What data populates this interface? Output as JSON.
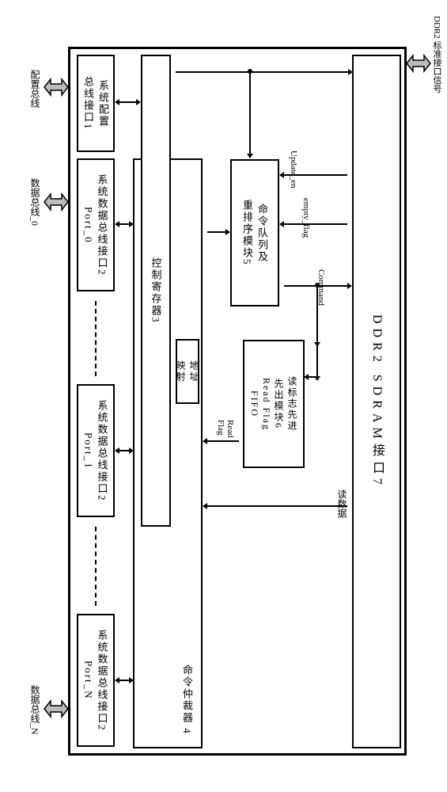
{
  "external": {
    "config_bus": "配置总线",
    "data_bus_0": "数据总线_0",
    "data_bus_n": "数据总线_N",
    "ddr2_signal": "DDR2 标准接口信号"
  },
  "blocks": {
    "config_if": "系统配置\n总线接口1",
    "data_port0": "系统数据总线接口2\nPort_0",
    "data_port1": "系统数据总线接口2\nPort_1",
    "data_portN": "系统数据总线接口2\nPort_N",
    "ctrl_reg": "控制寄存器3",
    "cmd_arbiter": "命令仲裁器  4",
    "addr_map": "地址\n映射",
    "cmd_queue": "命令队列及\n重排序模块5",
    "read_fifo": "读标志先进\n先出模块6\nRead Flag\nFIFO",
    "ddr_if": "DDR2 SDRAM接口7"
  },
  "signals": {
    "update_en": "Update_en",
    "empty_flag": "empty_flag",
    "command": "Command",
    "read_flag": "Read\nFlag",
    "read_data": "读数据"
  }
}
